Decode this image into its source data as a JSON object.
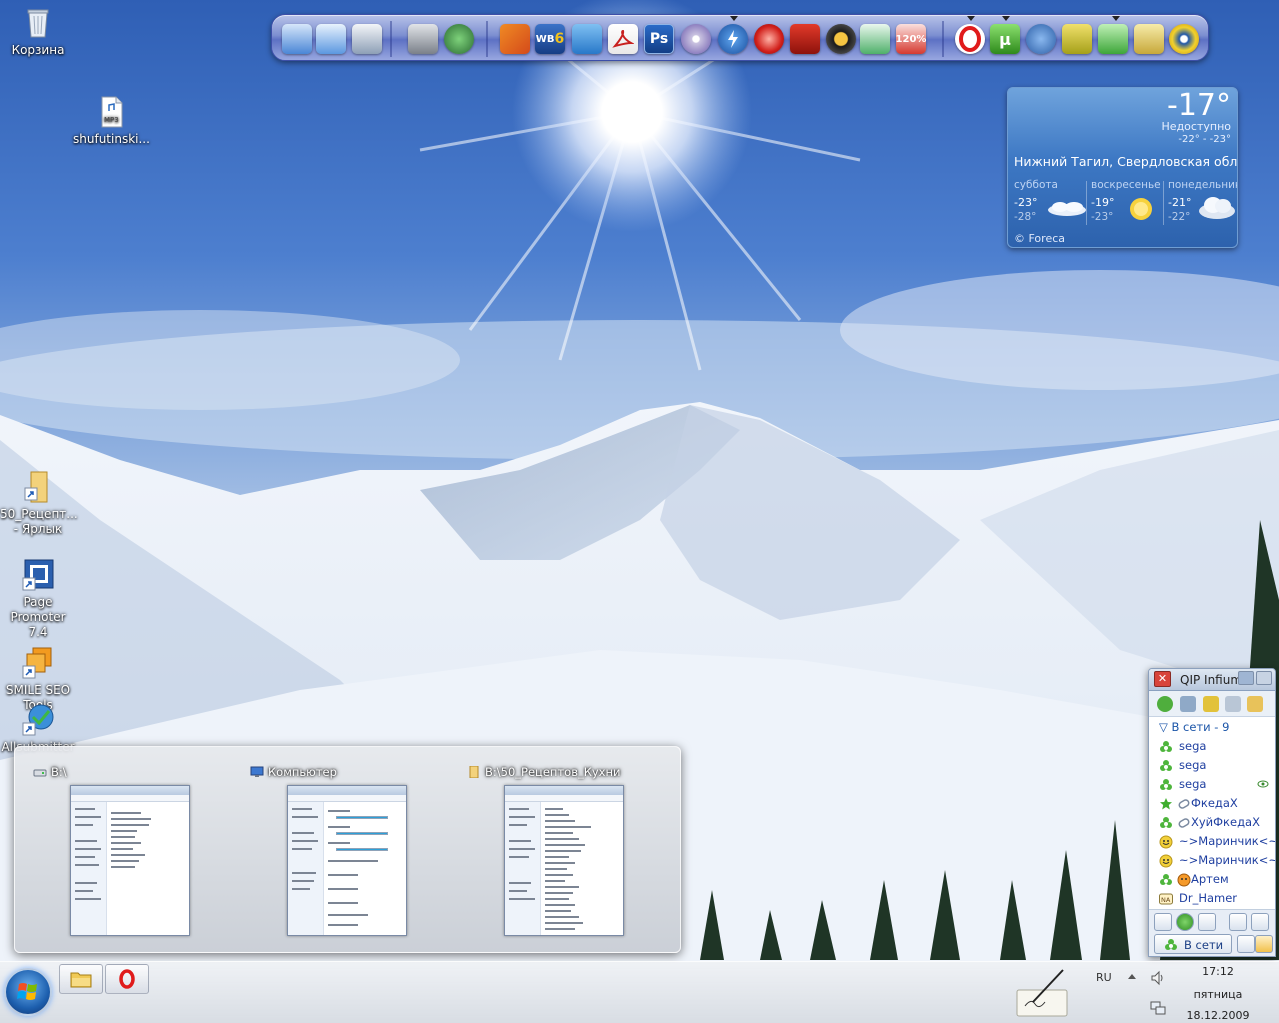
{
  "desktop": {
    "icons": [
      {
        "label": "Корзина",
        "icon": "recycle-bin-icon"
      },
      {
        "label": "shufutinski...",
        "icon": "mp3-file-icon",
        "badge": "MP3"
      },
      {
        "label": "50_Рецепт...\n- Ярлык",
        "icon": "folder-shortcut-icon"
      },
      {
        "label": "Page\nPromoter 7.4",
        "icon": "page-promoter-icon"
      },
      {
        "label": "SMILE SEO\nTools",
        "icon": "smile-seo-icon"
      },
      {
        "label": "Allsubmitter",
        "icon": "allsubmitter-icon"
      }
    ]
  },
  "dock": {
    "icons": [
      "computer-icon",
      "control-panel-icon",
      "tools-icon",
      "printer-icon",
      "alien-icon",
      "pencil-icon",
      "wb-icon",
      "book-icon",
      "acrobat-icon",
      "photoshop-icon",
      "disc-icon",
      "lightning-icon",
      "nero-icon",
      "vector-icon",
      "aimp-icon",
      "cards-icon",
      "dial-icon",
      "opera-icon",
      "utorrent-icon",
      "gear-icon",
      "network-icon",
      "cleaner-icon",
      "notes-icon",
      "webcam-icon"
    ],
    "labels": {
      "wb": "WB",
      "wb_sub": "6",
      "ps": "Ps",
      "dial": "120%"
    }
  },
  "weather": {
    "temp": "-17°",
    "condition": "Недоступно",
    "range": "-22°  -  -23°",
    "city": "Нижний Тагил, Свердловская обл...",
    "days": [
      {
        "name": "суббота",
        "hi": "-23°",
        "lo": "-28°",
        "icon": "cloud-icon"
      },
      {
        "name": "воскресенье",
        "hi": "-19°",
        "lo": "-23°",
        "icon": "sun-icon"
      },
      {
        "name": "понедельник",
        "hi": "-21°",
        "lo": "-22°",
        "icon": "cloudy-icon"
      }
    ],
    "credit": "© Foreca"
  },
  "thumbnails": [
    {
      "title": "B:\\",
      "icon": "drive-icon"
    },
    {
      "title": "Компьютер",
      "icon": "computer-icon"
    },
    {
      "title": "B:\\50_Рецептов_Кухни",
      "icon": "folder-icon"
    }
  ],
  "qip": {
    "title": "QIP Infium",
    "group": "В сети - 9",
    "contacts": [
      {
        "name": "sega",
        "status": "online-icon"
      },
      {
        "name": "sega",
        "status": "online-icon"
      },
      {
        "name": "sega",
        "status": "online-icon",
        "extra": "eye-icon"
      },
      {
        "name": "ФкедаХ",
        "status": "star-icon",
        "extra": "paperclip-icon"
      },
      {
        "name": "ХуйФкедаХ",
        "status": "online-icon",
        "extra": "paperclip-icon"
      },
      {
        "name": "~>Маринчик<~",
        "status": "smile-icon"
      },
      {
        "name": "~>Маринчик<~",
        "status": "smile-icon"
      },
      {
        "name": "Артем",
        "status": "online-icon",
        "extra": "face-icon"
      },
      {
        "name": "Dr_Hamer",
        "status": "na-icon"
      }
    ],
    "status_label": "В сети"
  },
  "taskbar": {
    "pinned": [
      "explorer-icon",
      "opera-icon"
    ],
    "lang": "RU",
    "time": "17:12",
    "day": "пятница",
    "date": "18.12.2009"
  }
}
